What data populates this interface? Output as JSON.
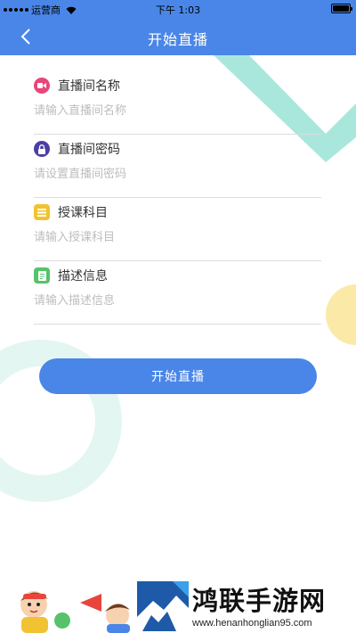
{
  "status_bar": {
    "carrier": "运营商",
    "time": "下午 1:03"
  },
  "nav": {
    "title": "开始直播"
  },
  "form": {
    "fields": [
      {
        "label": "直播间名称",
        "placeholder": "请输入直播间名称",
        "icon": "video-icon",
        "icon_color": "#e9457a"
      },
      {
        "label": "直播间密码",
        "placeholder": "请设置直播间密码",
        "icon": "lock-icon",
        "icon_color": "#4a3fa3"
      },
      {
        "label": "授课科目",
        "placeholder": "请输入授课科目",
        "icon": "list-icon",
        "icon_color": "#f1c232"
      },
      {
        "label": "描述信息",
        "placeholder": "请输入描述信息",
        "icon": "document-icon",
        "icon_color": "#57c26a"
      }
    ]
  },
  "start_button": {
    "label": "开始直播"
  },
  "watermark": {
    "title": "鸿联手游网",
    "url": "www.henanhonglian95.com"
  },
  "colors": {
    "primary": "#4a86e8",
    "deco_teal": "#a9e7dc",
    "deco_teal_light": "#e3f6f2",
    "deco_yellow": "#fbe9a8"
  }
}
